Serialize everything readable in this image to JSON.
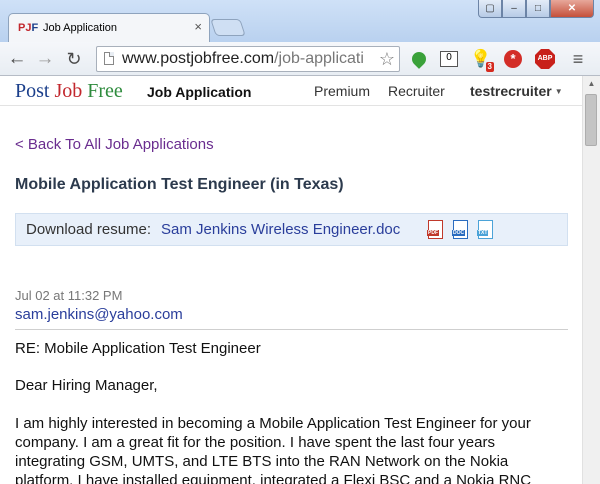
{
  "browser": {
    "tab": {
      "favicon_text_a": "PJ",
      "favicon_text_b": "F",
      "title": "Job Application",
      "close_glyph": "×"
    },
    "window_buttons": {
      "user": "▢",
      "minimize": "–",
      "maximize": "□",
      "close": "✕"
    },
    "toolbar": {
      "back_glyph": "←",
      "forward_glyph": "→",
      "reload_glyph": "↻",
      "url_host": "www.postjobfree.com",
      "url_path": "/job-applicati",
      "star_glyph": "☆",
      "counter_value": "0",
      "bulb_glyph": "💡",
      "bulb_badge": "3",
      "lastpass_glyph": "*",
      "abp_label": "ABP",
      "menu_glyph": "≡"
    }
  },
  "site": {
    "logo": {
      "part1": "Post ",
      "part2": "Job ",
      "part3": "Free"
    },
    "nav_title": "Job Application",
    "nav_links": {
      "premium": "Premium",
      "recruiter": "Recruiter"
    },
    "user": "testrecruiter",
    "user_caret": "▼"
  },
  "page": {
    "back_link": "< Back To All Job Applications",
    "job_title": "Mobile Application Test Engineer (in Texas)",
    "download": {
      "label": "Download resume:",
      "filename": "Sam Jenkins Wireless Engineer.doc",
      "pdf_label": "PDF",
      "doc_label": "DOC",
      "txt_label": "TXT"
    },
    "message": {
      "date": "Jul 02 at 11:32 PM",
      "from": "sam.jenkins@yahoo.com",
      "subject": "RE: Mobile Application Test Engineer",
      "greeting": "Dear Hiring Manager,",
      "body_lines": [
        "I am highly interested in becoming a Mobile Application Test Engineer for your",
        "company. I am a great fit for the position. I have spent the last four years",
        "integrating GSM, UMTS, and LTE BTS into the RAN Network on the Nokia",
        "platform. I have installed equipment, integrated a Flexi BSC and a Nokia RNC"
      ]
    }
  },
  "scrollbar": {
    "up_glyph": "▲"
  },
  "colors": {
    "logo_post": "#1b3f8b",
    "logo_job": "#c2272d",
    "logo_free": "#2e8b3d",
    "link_visited": "#6a2d8f",
    "link": "#2a3e9b",
    "download_bg": "#e8f0fa"
  }
}
